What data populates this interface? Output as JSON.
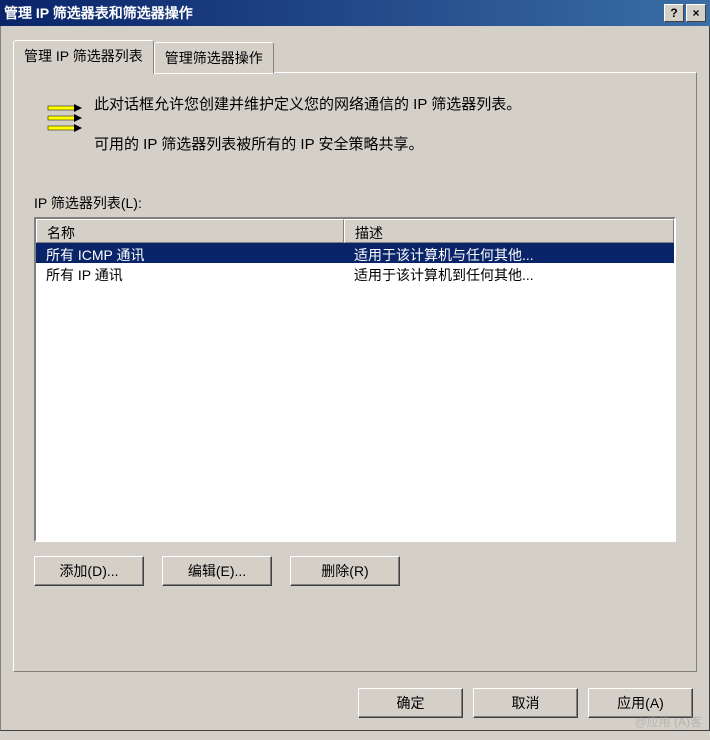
{
  "window": {
    "title": "管理 IP 筛选器表和筛选器操作"
  },
  "tabs": {
    "tab1": "管理 IP 筛选器列表",
    "tab2": "管理筛选器操作"
  },
  "info": {
    "line1": "此对话框允许您创建并维护定义您的网络通信的 IP 筛选器列表。",
    "line2": "可用的 IP 筛选器列表被所有的 IP 安全策略共享。"
  },
  "list": {
    "label": "IP 筛选器列表(L):",
    "columns": {
      "name": "名称",
      "desc": "描述"
    },
    "rows": [
      {
        "name": "所有 ICMP 通讯",
        "desc": "适用于该计算机与任何其他..."
      },
      {
        "name": "所有 IP 通讯",
        "desc": "适用于该计算机到任何其他..."
      }
    ]
  },
  "buttons": {
    "add": "添加(D)...",
    "edit": "编辑(E)...",
    "remove": "删除(R)"
  },
  "footer": {
    "ok": "确定",
    "cancel": "取消",
    "apply": "应用(A)"
  }
}
